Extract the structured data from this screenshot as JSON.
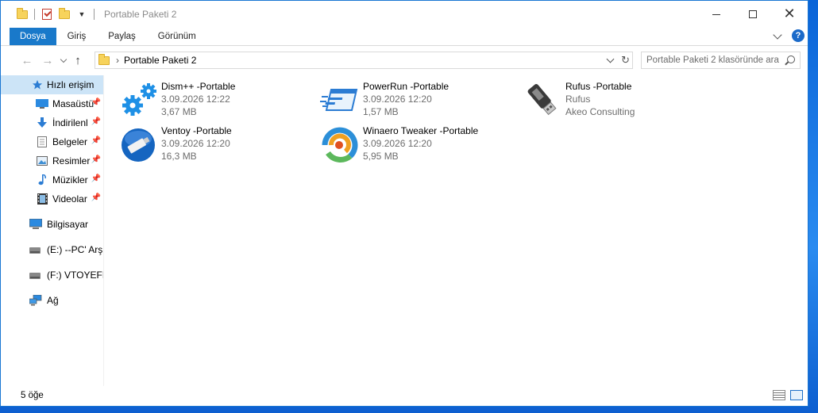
{
  "window": {
    "title": "Portable Paketi 2"
  },
  "ribbon": {
    "tabs": [
      "Dosya",
      "Giriş",
      "Paylaş",
      "Görünüm"
    ],
    "help_label": "?"
  },
  "address": {
    "path": "Portable Paketi 2",
    "search_placeholder": "Portable Paketi 2 klasöründe ara"
  },
  "nav": {
    "quick_access": "Hızlı erişim",
    "items": [
      {
        "label": "Masaüstü",
        "icon": "desktop-icon",
        "pinned": true
      },
      {
        "label": "İndirilenl",
        "icon": "download-icon",
        "pinned": true
      },
      {
        "label": "Belgeler",
        "icon": "documents-icon",
        "pinned": true
      },
      {
        "label": "Resimler",
        "icon": "pictures-icon",
        "pinned": true
      },
      {
        "label": "Müzikler",
        "icon": "music-icon",
        "pinned": true
      },
      {
        "label": "Videolar",
        "icon": "video-icon",
        "pinned": true
      }
    ],
    "computer": "Bilgisayar",
    "drives": [
      {
        "label": "(E:) --PC' Arşi",
        "icon": "drive-icon"
      },
      {
        "label": "(F:) VTOYEFI",
        "icon": "drive-icon"
      }
    ],
    "network": "Ağ"
  },
  "files": [
    {
      "name": "Dism++ -Portable",
      "line2": "3.09.2026 12:22",
      "line3": "3,67 MB",
      "icon": "gears-icon"
    },
    {
      "name": "PowerRun -Portable",
      "line2": "3.09.2026 12:20",
      "line3": "1,57 MB",
      "icon": "powerrun-icon"
    },
    {
      "name": "Rufus -Portable",
      "line2": "Rufus",
      "line3": "Akeo Consulting",
      "icon": "usb-drive-icon"
    },
    {
      "name": "Ventoy -Portable",
      "line2": "3.09.2026 12:20",
      "line3": "16,3 MB",
      "icon": "ventoy-icon"
    },
    {
      "name": "Winaero Tweaker -Portable",
      "line2": "3.09.2026 12:20",
      "line3": "5,95 MB",
      "icon": "winaero-icon"
    }
  ],
  "status": {
    "count": "5 öğe"
  },
  "colors": {
    "accent": "#1979ca",
    "selected_bg": "#cce4f7",
    "folder": "#f7d35c"
  }
}
